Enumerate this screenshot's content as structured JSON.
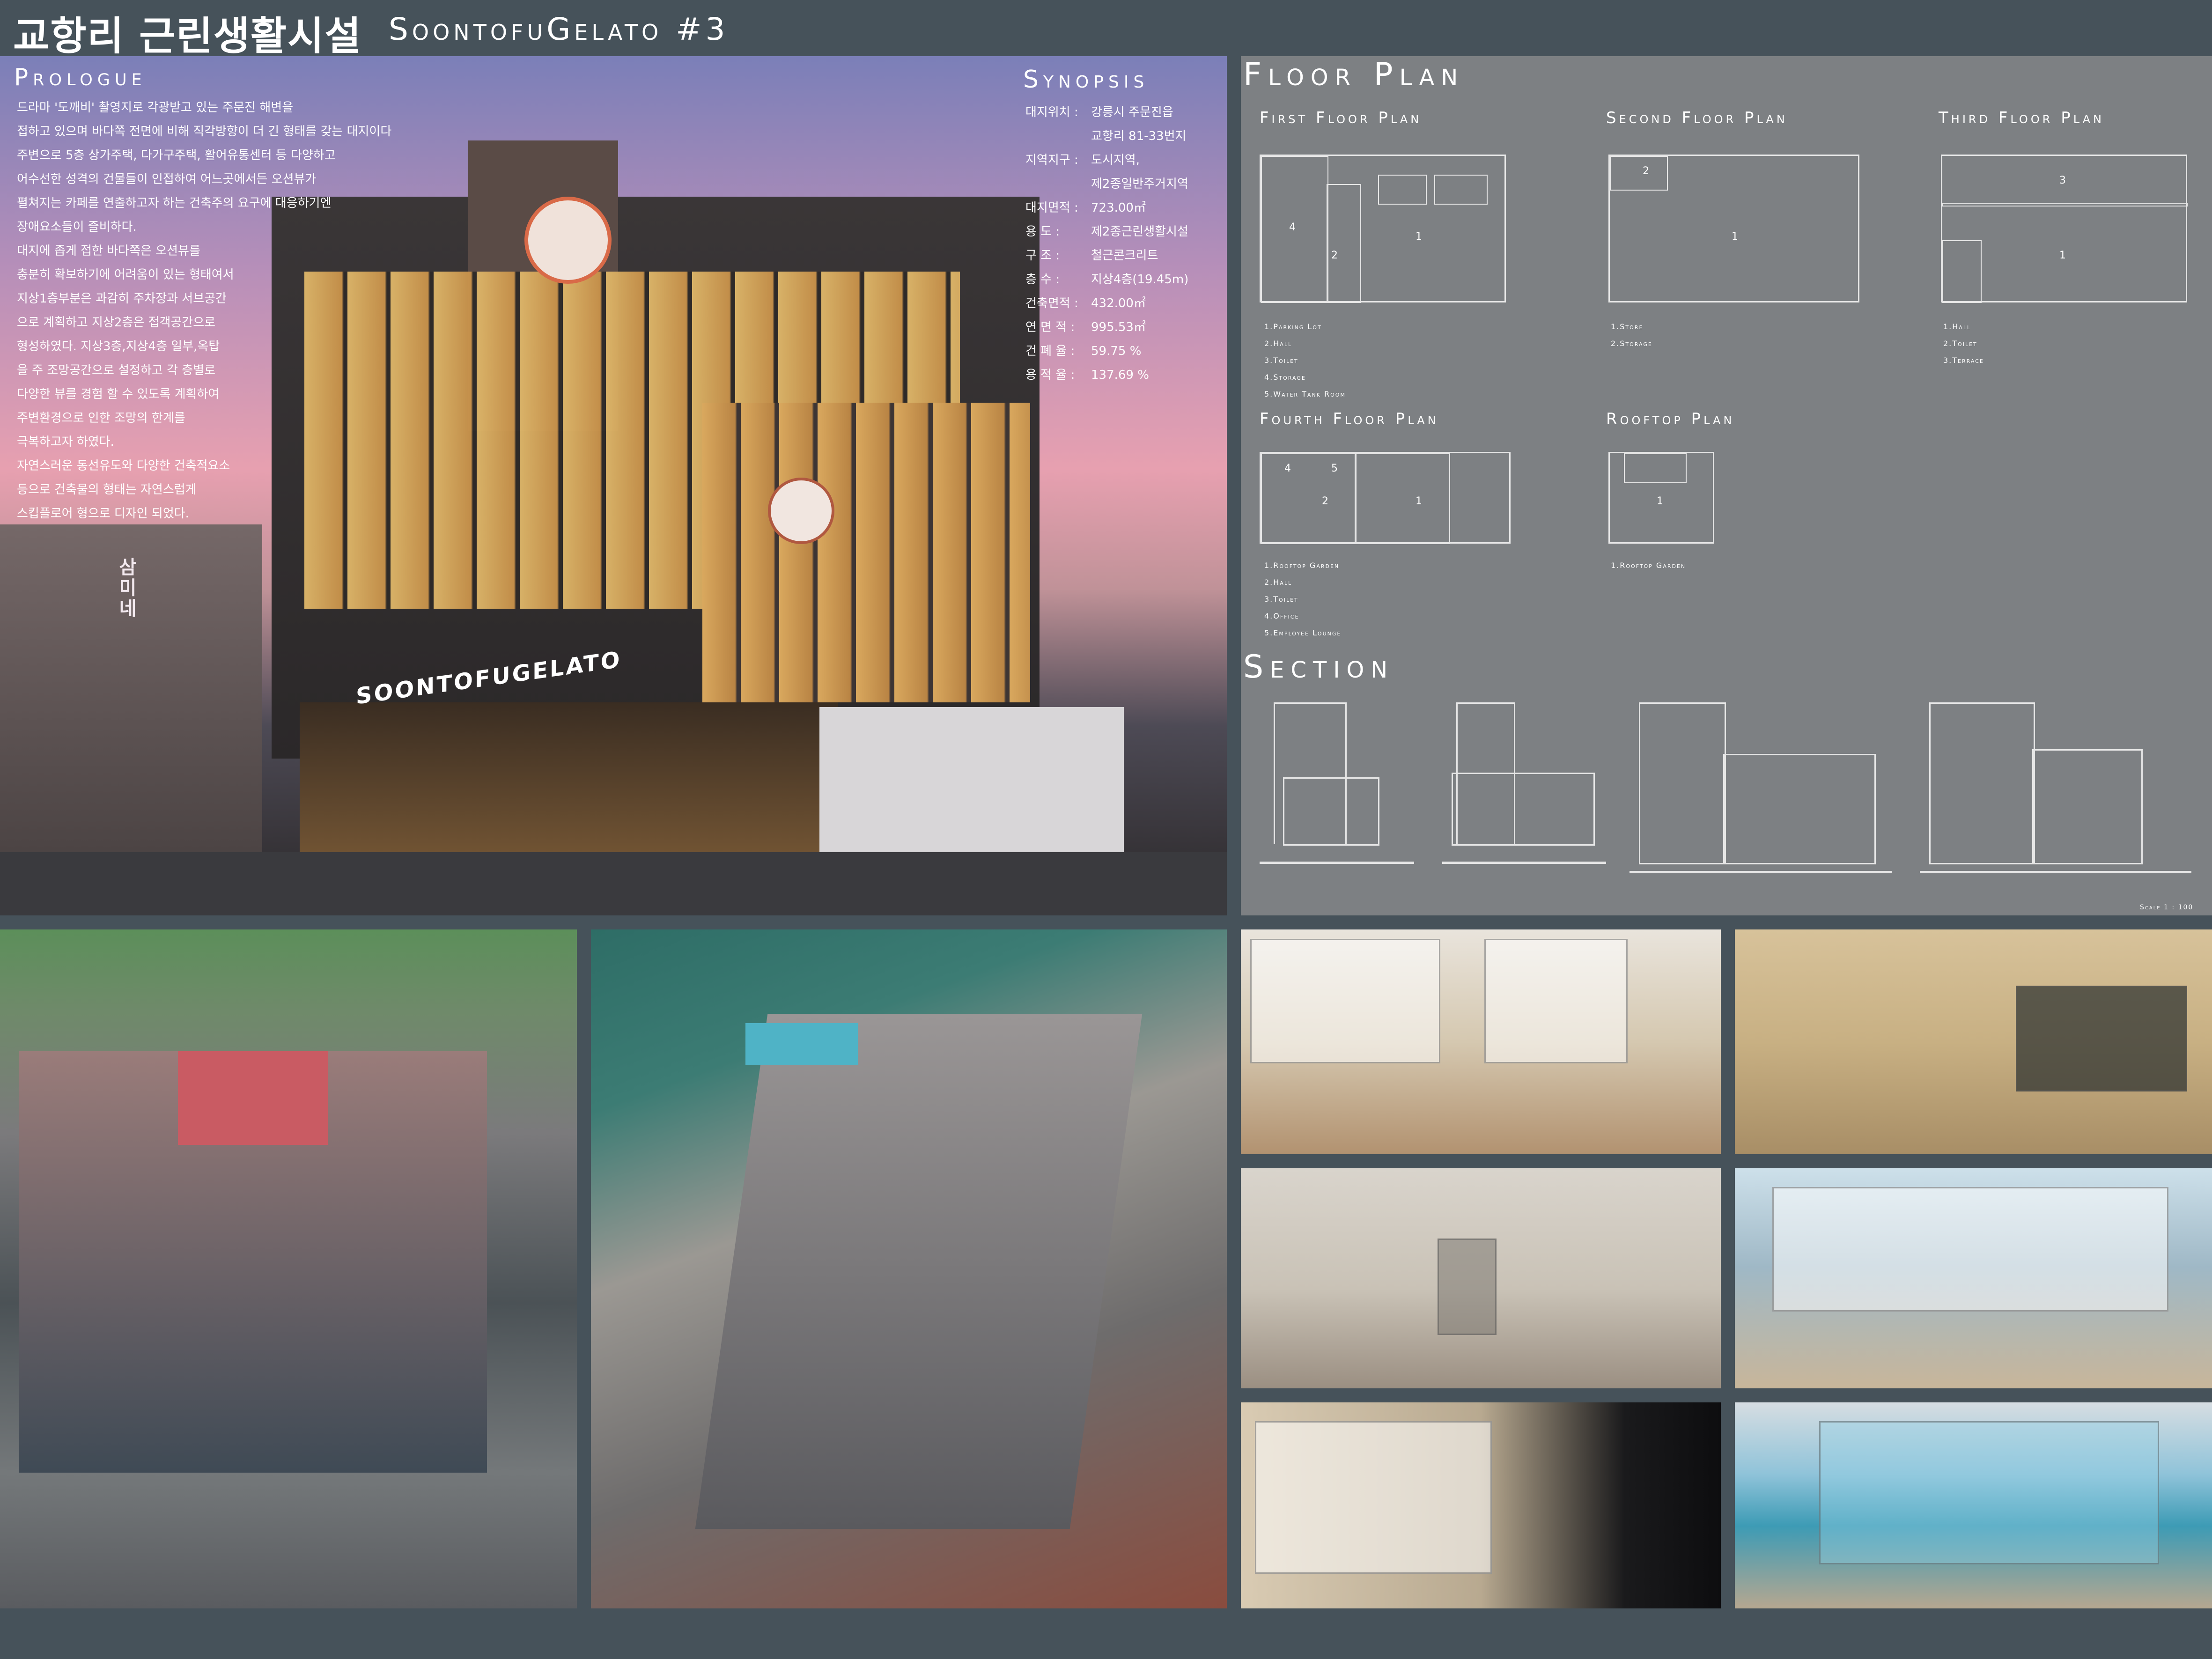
{
  "title": {
    "main": "교항리 근린생활시설",
    "sub": "SoontofuGelato #3"
  },
  "prologue": {
    "heading": "Prologue",
    "lines": [
      "드라마 '도깨비' 촬영지로 각광받고 있는 주문진 해변을",
      "접하고 있으며 바다쪽 전면에 비해 직각방향이 더 긴 형태를 갖는 대지이다",
      "주변으로 5층 상가주택, 다가구주택, 활어유통센터 등 다양하고",
      "어수선한 성격의 건물들이 인접하여 어느곳에서든 오션뷰가",
      "펼쳐지는 카페를 연출하고자 하는 건축주의 요구에 대응하기엔",
      "장애요소들이 즐비하다.",
      "대지에 좁게 접한 바다쪽은 오션뷰를",
      "충분히 확보하기에 어려움이 있는 형태여서",
      "지상1층부분은 과감히 주차장과 서브공간",
      "으로 계획하고 지상2층은 접객공간으로",
      "형성하였다. 지상3층,지상4층 일부,옥탑",
      "을 주 조망공간으로 설정하고 각 층별로",
      "다양한 뷰를 경험 할 수 있도록 계획하여",
      "주변환경으로 인한 조망의 한계를",
      "극복하고자 하였다.",
      "자연스러운 동선유도와 다양한 건축적요소",
      "등으로 건축물의 형태는 자연스럽게",
      "스킵플로어 형으로 디자인 되었다."
    ]
  },
  "synopsis": {
    "heading": "Synopsis",
    "rows": [
      {
        "k": "대지위치 :",
        "v": "강릉시 주문진읍"
      },
      {
        "k": "",
        "v": "교항리 81-33번지"
      },
      {
        "k": "지역지구 :",
        "v": "도시지역,"
      },
      {
        "k": "",
        "v": "제2종일반주거지역"
      },
      {
        "k": "대지면적 :",
        "v": "723.00㎡"
      },
      {
        "k": "용    도 :",
        "v": "제2종근린생활시설"
      },
      {
        "k": "구    조 :",
        "v": "철근콘크리트"
      },
      {
        "k": "층    수 :",
        "v": "지상4층(19.45m)"
      },
      {
        "k": "건축면적 :",
        "v": "432.00㎡"
      },
      {
        "k": "연 면 적 :",
        "v": "995.53㎡"
      },
      {
        "k": "건 폐 율 :",
        "v": "59.75 %"
      },
      {
        "k": "용 적 율 :",
        "v": "137.69 %"
      }
    ]
  },
  "hero": {
    "signage": "SOONTOFUGELATO",
    "side_sign": "삼미네"
  },
  "floor_plan": {
    "heading": "Floor Plan",
    "first": {
      "title": "First Floor Plan",
      "legend": [
        "1.Parking Lot",
        "2.Hall",
        "3.Toilet",
        "4.Storage",
        "5.Water Tank Room"
      ]
    },
    "second": {
      "title": "Second Floor Plan",
      "legend": [
        "1.Store",
        "2.Storage"
      ]
    },
    "third": {
      "title": "Third Floor Plan",
      "legend": [
        "1.Hall",
        "2.Toilet",
        "3.Terrace"
      ]
    },
    "fourth": {
      "title": "Fourth Floor Plan",
      "legend": [
        "1.Rooftop Garden",
        "2.Hall",
        "3.Toilet",
        "4.Office",
        "5.Employee Lounge"
      ]
    },
    "rooftop": {
      "title": "Rooftop Plan",
      "legend": [
        "1.Rooftop Garden"
      ]
    }
  },
  "section": {
    "heading": "Section",
    "scale": "Scale 1 : 100"
  },
  "colors": {
    "background": "#46525a",
    "panel": "#7d8083",
    "text": "#ffffff"
  }
}
